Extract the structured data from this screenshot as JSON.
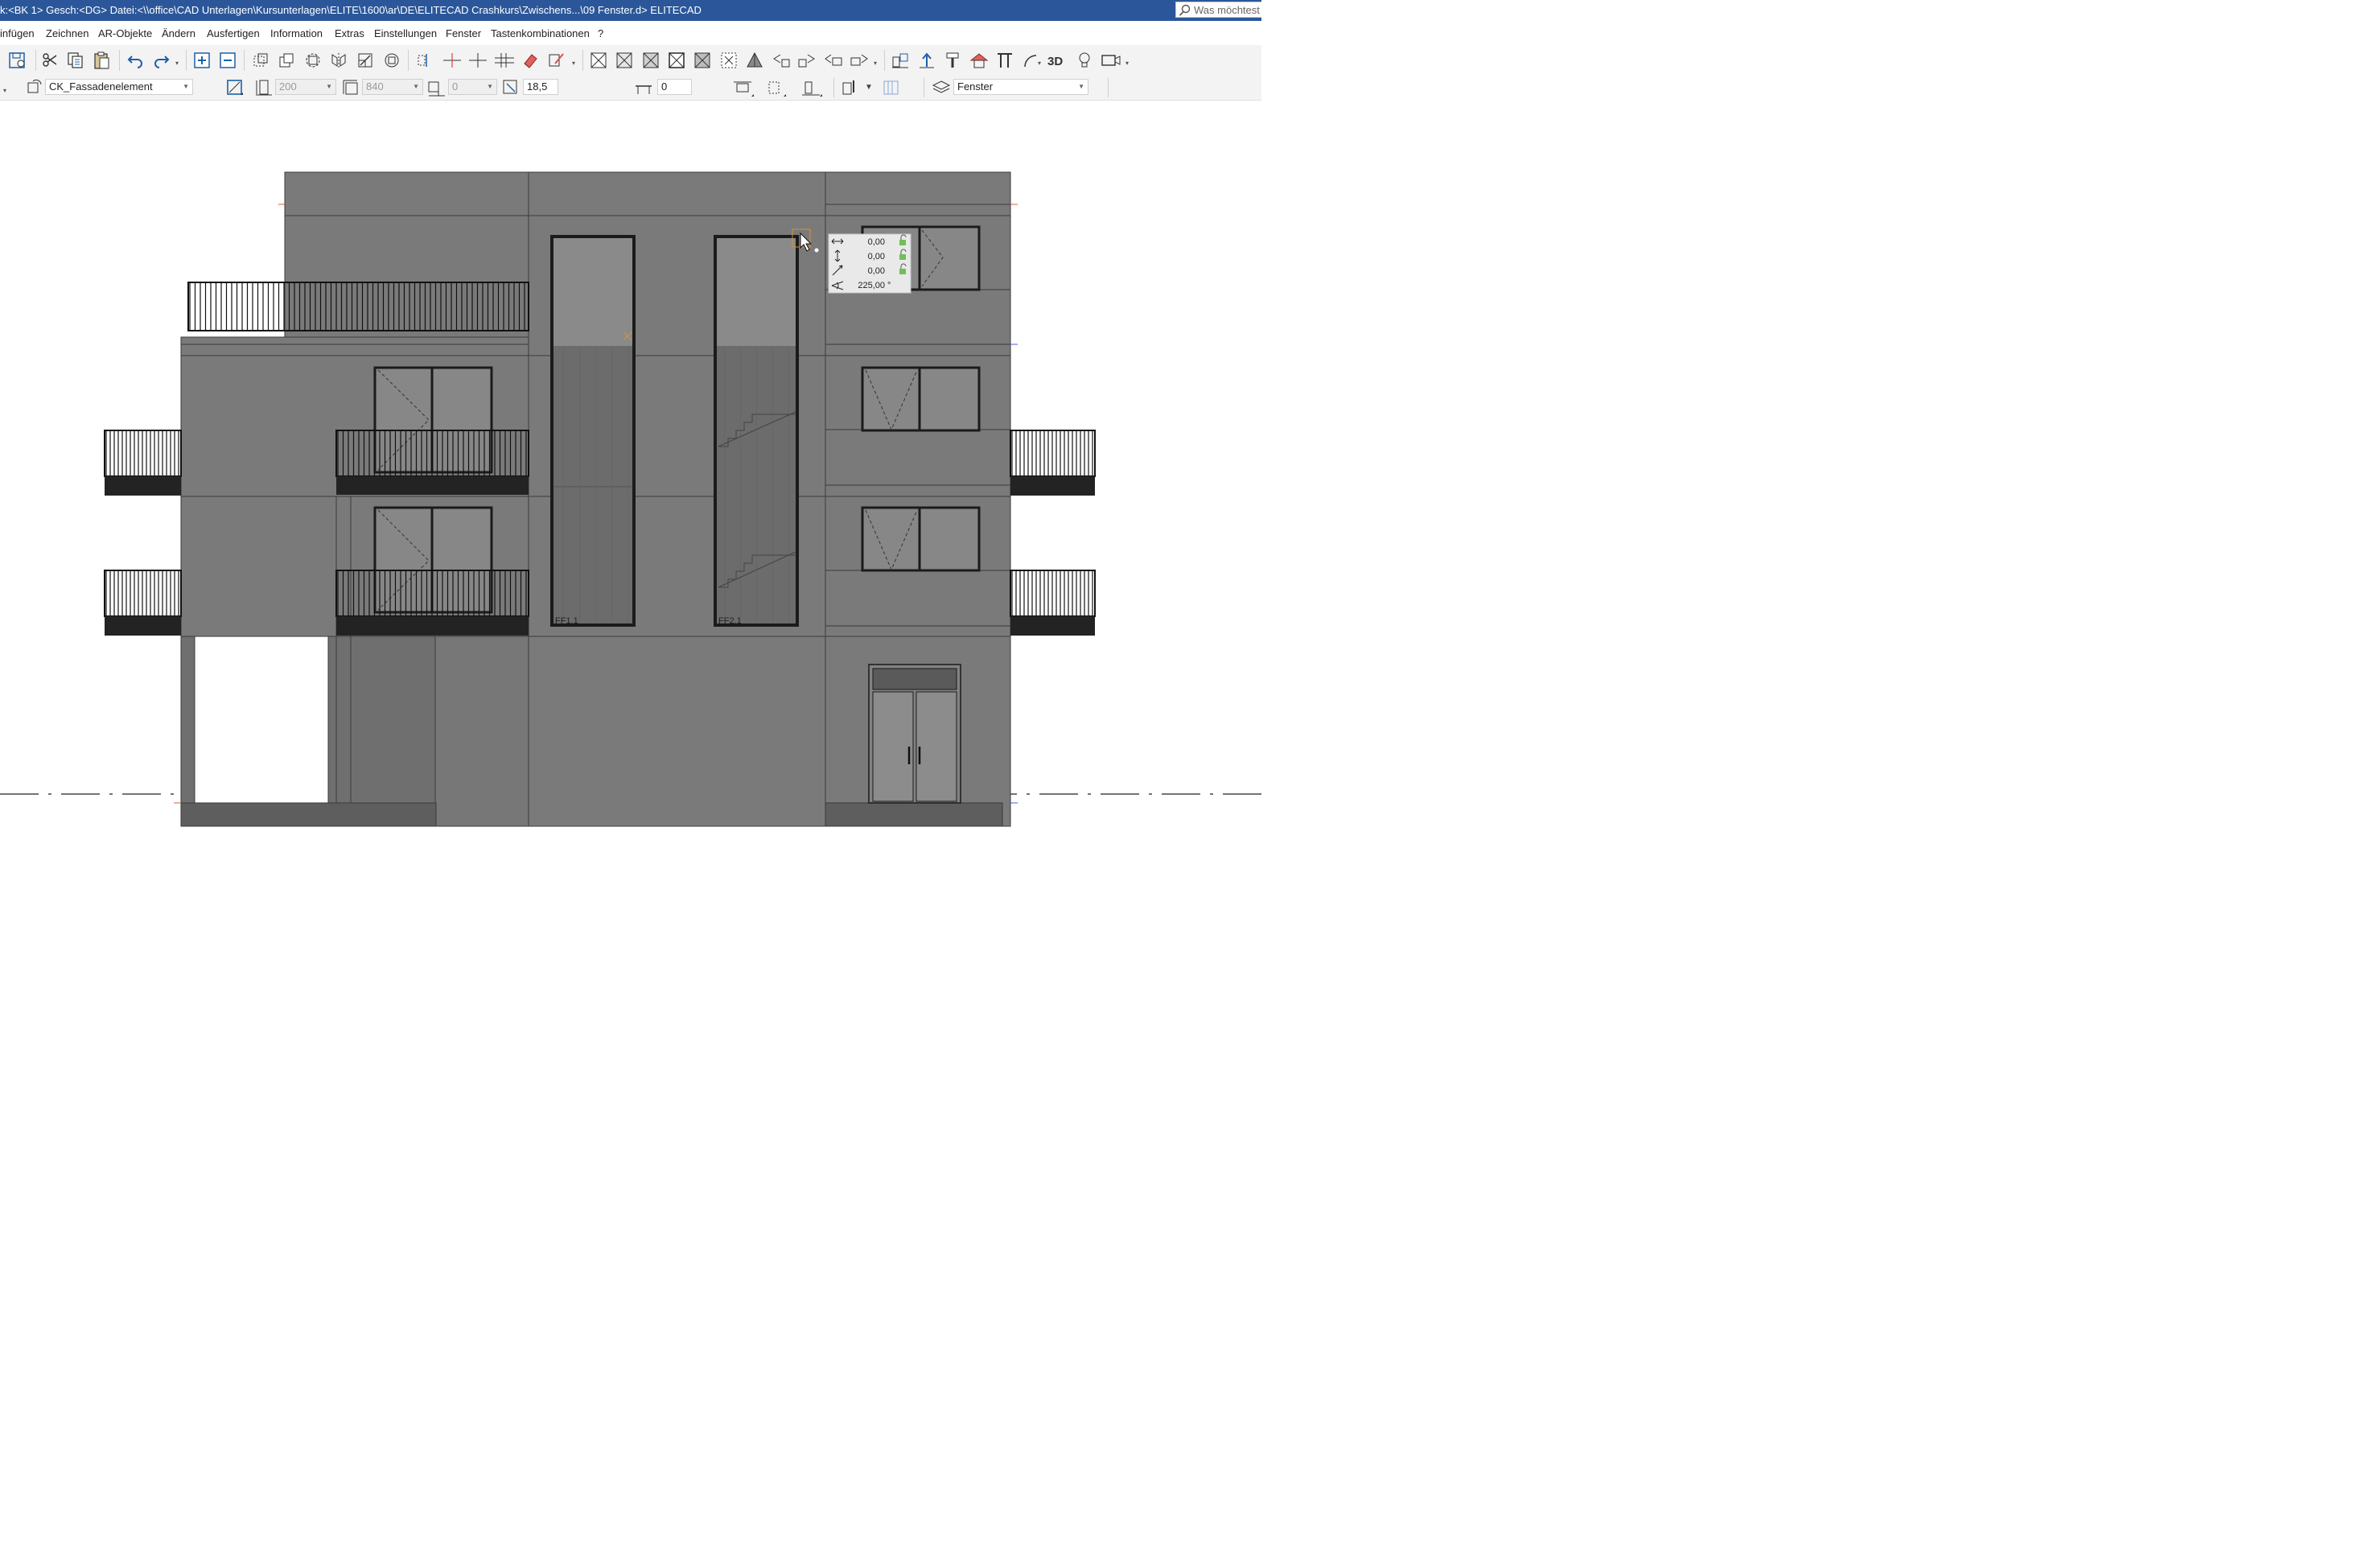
{
  "window": {
    "title": "k:<BK 1>  Gesch:<DG>  Datei:<\\\\office\\CAD Unterlagen\\Kursunterlagen\\ELITE\\1600\\ar\\DE\\ELITECAD Crashkurs\\Zwischens...\\09 Fenster.d> ELITECAD",
    "search_placeholder": "Was möchtest d"
  },
  "menu": {
    "items": [
      "infügen",
      "Zeichnen",
      "AR-Objekte",
      "Ändern",
      "Ausfertigen",
      "Information",
      "Extras",
      "Einstellungen",
      "Fenster",
      "Tastenkombinationen",
      "?"
    ]
  },
  "props": {
    "element_type": "CK_Fassadenelement",
    "height": "200",
    "width": "840",
    "offset": "0",
    "scale": "18,5",
    "spacing": "0",
    "layer": "Fenster"
  },
  "coord_popup": {
    "dx": "0,00",
    "dy": "0,00",
    "dist": "0,00",
    "angle": "225,00",
    "angle_unit": "°"
  },
  "labels": {
    "window_ff1": "FF1.1",
    "window_ff2": "FF2.1"
  },
  "colors": {
    "titlebar": "#2b579a",
    "facade": "#7a7a7a",
    "facade_dark": "#6c6c6c",
    "frame": "#1b1b1b",
    "glass": "#868686",
    "slab": "#232323"
  }
}
